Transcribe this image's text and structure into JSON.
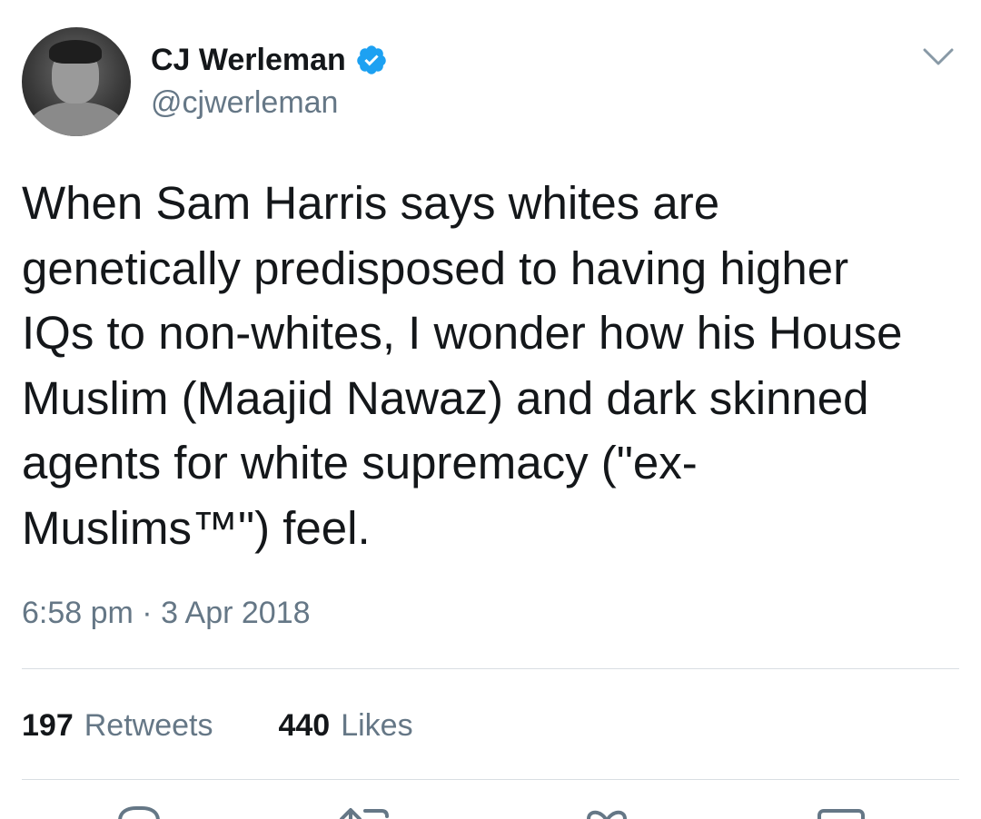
{
  "author": {
    "display_name": "CJ Werleman",
    "handle": "@cjwerleman",
    "verified": true
  },
  "tweet": {
    "text": "When Sam Harris says whites are\ngenetically predisposed to having higher\nIQs to non-whites, I wonder how his House\nMuslim (Maajid Nawaz) and dark skinned\nagents for white supremacy (\"ex-\nMuslims™\") feel.",
    "timestamp": "6:58 pm · 3 Apr 2018"
  },
  "stats": {
    "retweets_count": "197",
    "retweets_label": "Retweets",
    "likes_count": "440",
    "likes_label": "Likes"
  },
  "icons": {
    "verified": "verified-badge-icon",
    "caret": "chevron-down-icon",
    "reply": "reply-icon",
    "retweet": "retweet-icon",
    "like": "heart-icon",
    "share": "share-icon"
  },
  "colors": {
    "accent": "#1da1f2",
    "text_primary": "#14171a",
    "text_secondary": "#657786",
    "divider": "#d9dee2"
  }
}
